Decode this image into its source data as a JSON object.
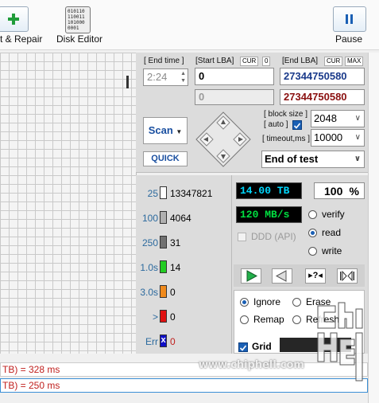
{
  "toolbar": {
    "test_repair_label": "t & Repair",
    "disk_editor_label": "Disk Editor",
    "disk_editor_icon_text": [
      "010110",
      "110011",
      "101000",
      "0001"
    ],
    "pause_label": "Pause"
  },
  "lba": {
    "end_time_label": "[ End time ]",
    "end_time_value": "2:24",
    "start_lba_label": "[Start LBA]",
    "cur_label": "CUR",
    "cur_value": "0",
    "start_lba_value": "0",
    "start_lba_current": "0",
    "end_lba_label": "[End LBA]",
    "end_cur_label": "CUR",
    "max_label": "MAX",
    "end_lba_value": "27344750580",
    "end_lba_current": "27344750580"
  },
  "scan": {
    "scan_label": "Scan",
    "quick_label": "QUICK",
    "block_size_label": "[ block size ]",
    "auto_label": "[ auto ]",
    "block_size_value": "2048",
    "timeout_label": "[ timeout,ms ]",
    "timeout_value": "10000",
    "end_action_value": "End of test"
  },
  "stats": [
    {
      "label": "25",
      "color": "#ffffff",
      "value": "13347821"
    },
    {
      "label": "100",
      "color": "#b0b0b0",
      "value": "4064"
    },
    {
      "label": "250",
      "color": "#707070",
      "value": "31"
    },
    {
      "label": "1.0s",
      "color": "#22cc22",
      "value": "14"
    },
    {
      "label": "3.0s",
      "color": "#f08a1c",
      "value": "0"
    },
    {
      "label": ">",
      "color": "#e01010",
      "value": "0"
    },
    {
      "label": "Err",
      "color": "#1010c8",
      "value": "0",
      "mark": "x"
    }
  ],
  "progress": {
    "size": "14.00 TB",
    "percent": "100",
    "percent_sign": "%",
    "speed": "120 MB/s",
    "ddd_label": "DDD (API)"
  },
  "mode": {
    "verify": "verify",
    "read": "read",
    "write": "write",
    "selected": "read"
  },
  "repair": {
    "ignore": "Ignore",
    "erase": "Erase",
    "remap": "Remap",
    "refresh": "Refresh",
    "selected": "Ignore",
    "grid_label": "Grid"
  },
  "log": [
    {
      "text": "TB)  = 328 ms"
    },
    {
      "text": "TB)  = 250 ms"
    }
  ],
  "watermark": {
    "site": "www.chiphell.com",
    "logo": "chip hell"
  },
  "colors": {
    "accent": "#1a5fb4",
    "lcd_cyan": "#00d8ff",
    "lcd_green": "#00e040",
    "log_red": "#c0201e",
    "panel": "#dcdcdc"
  }
}
